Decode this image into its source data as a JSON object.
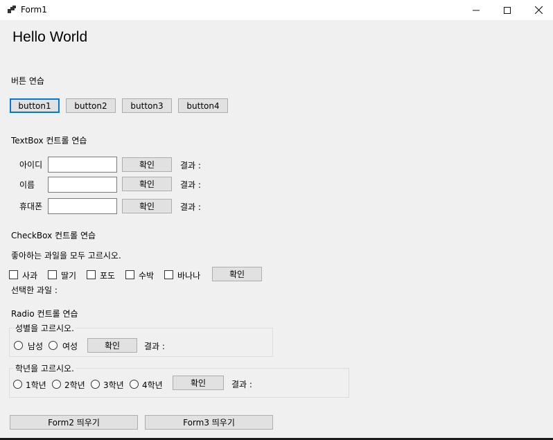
{
  "window": {
    "title": "Form1",
    "minimize_glyph": "—",
    "maximize_glyph": "☐",
    "close_glyph": "✕"
  },
  "hello": "Hello World",
  "buttons_section": {
    "label": "버튼 연습",
    "buttons": [
      "button1",
      "button2",
      "button3",
      "button4"
    ]
  },
  "textbox_section": {
    "label": "TextBox 컨트롤 연습",
    "rows": [
      {
        "label": "아이디",
        "value": "",
        "button": "확인",
        "result": "결과 :"
      },
      {
        "label": "이름",
        "value": "",
        "button": "확인",
        "result": "결과 :"
      },
      {
        "label": "휴대폰",
        "value": "",
        "button": "확인",
        "result": "결과 :"
      }
    ]
  },
  "checkbox_section": {
    "label": "CheckBox 컨트롤 연습",
    "prompt": "좋아하는 과일을 모두 고르시오.",
    "items": [
      "사과",
      "딸기",
      "포도",
      "수박",
      "바나나"
    ],
    "button": "확인",
    "selected_label": "선택한 과일 :"
  },
  "radio_section": {
    "label": "Radio 컨트롤 연습",
    "gender_group": {
      "caption": "성별을 고르시오.",
      "options": [
        "남성",
        "여성"
      ],
      "button": "확인",
      "result": "결과 :"
    },
    "grade_group": {
      "caption": "학년을 고르시오.",
      "options": [
        "1학년",
        "2학년",
        "3학년",
        "4학년"
      ],
      "button": "확인",
      "result": "결과 :"
    }
  },
  "footer": {
    "form2_button": "Form2 띄우기",
    "form3_button": "Form3 띄우기"
  }
}
